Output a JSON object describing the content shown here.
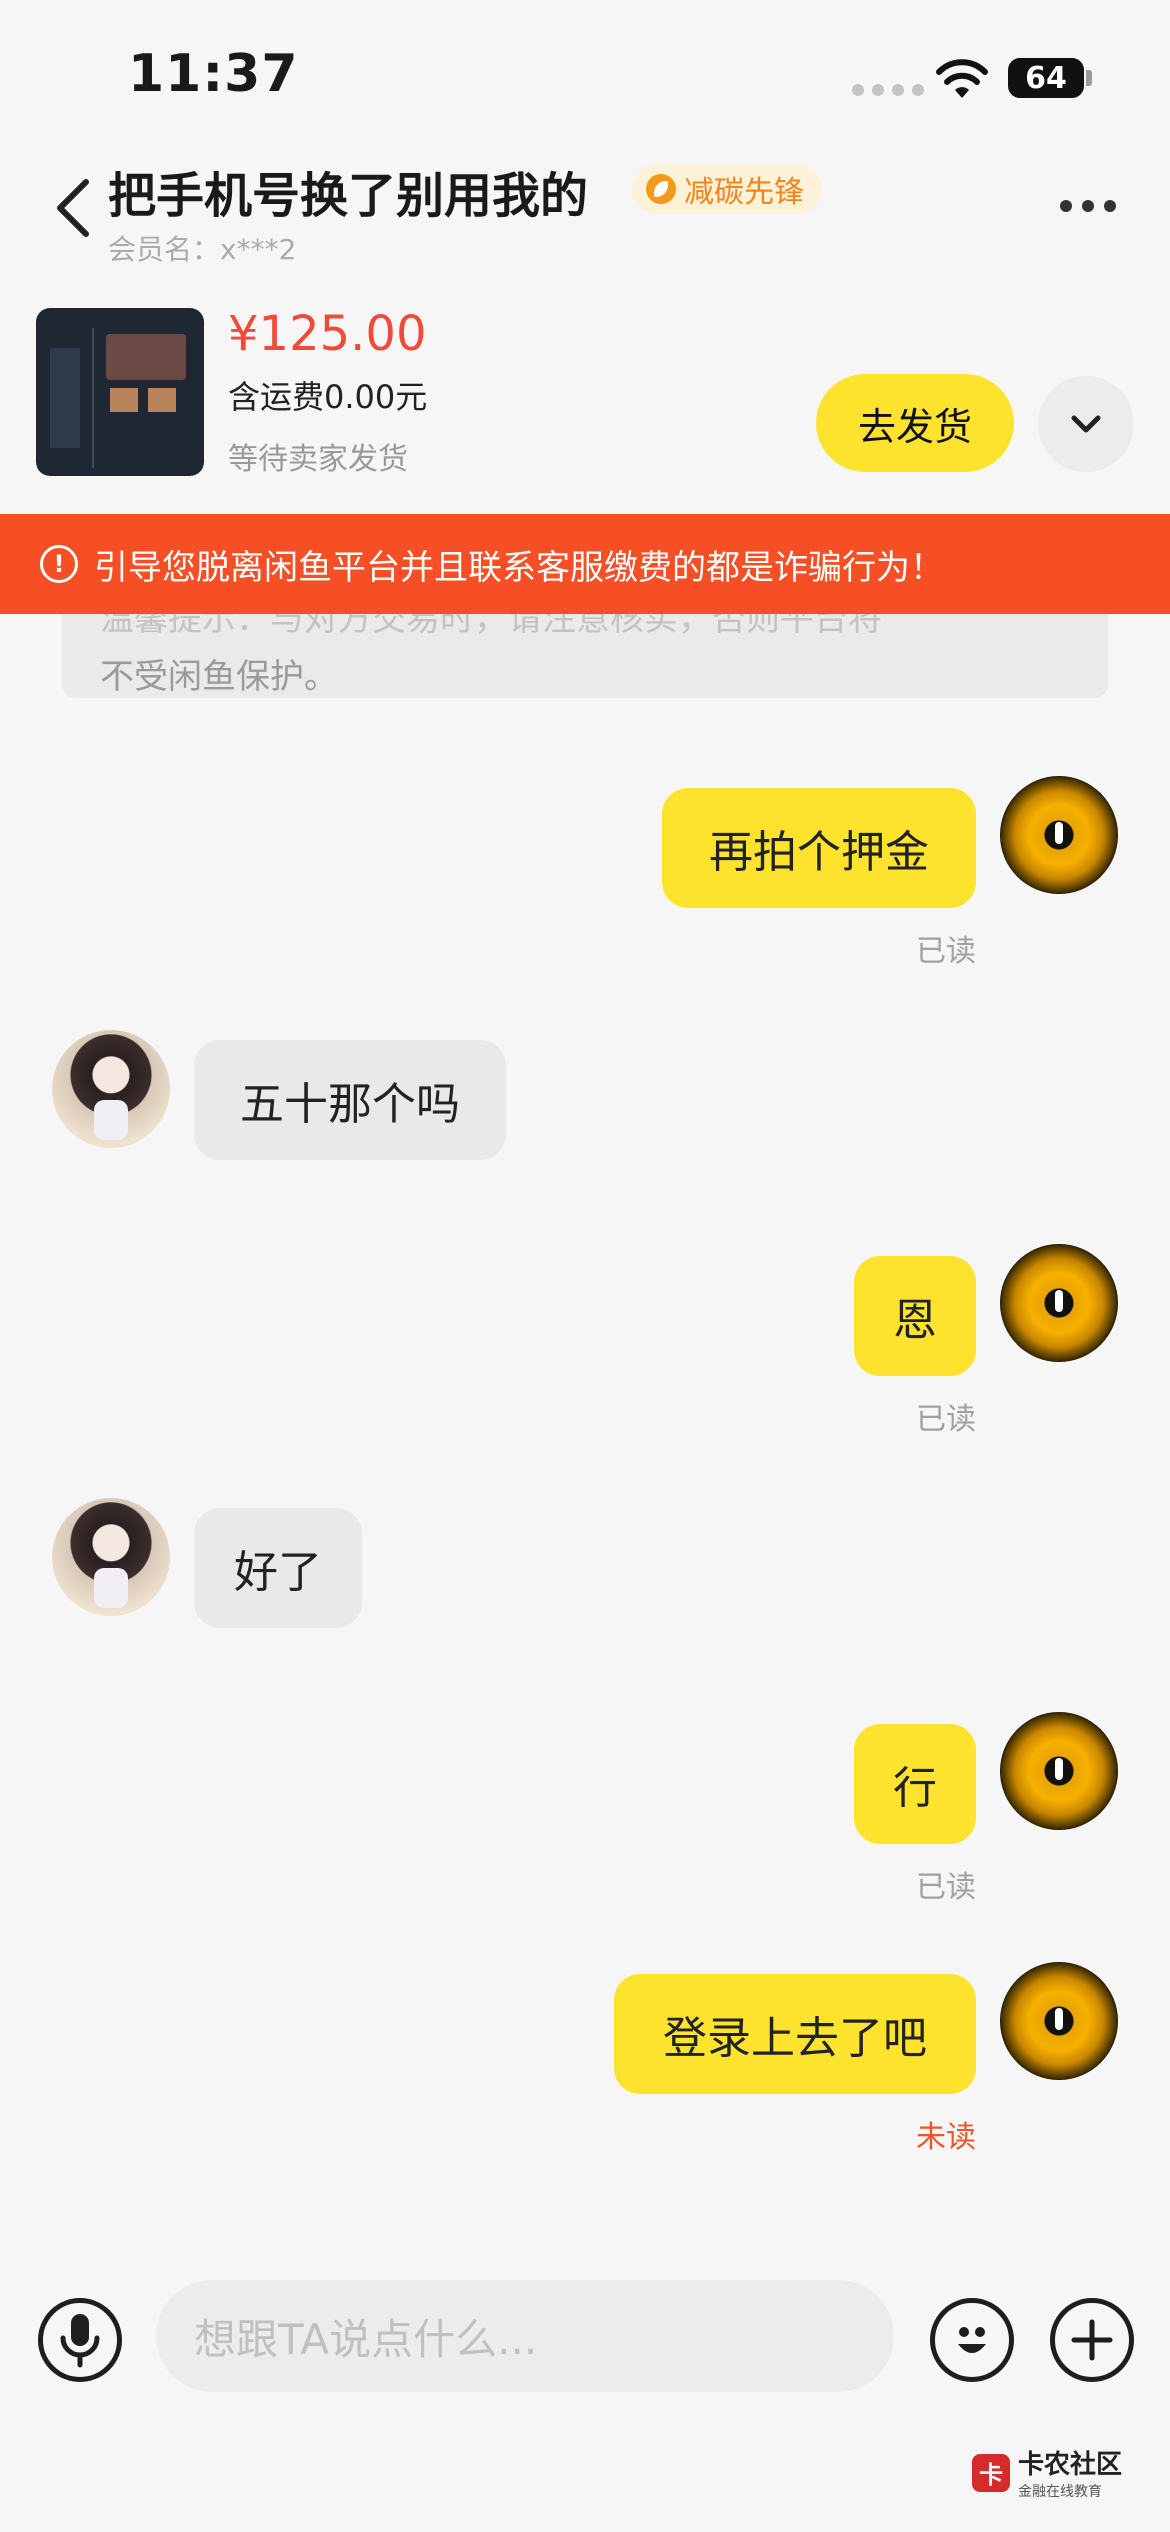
{
  "status_bar": {
    "time": "11:37",
    "battery": "64"
  },
  "header": {
    "title": "把手机号换了别用我的",
    "badge": "减碳先锋",
    "member": "会员名：x***2"
  },
  "product": {
    "price": "¥125.00",
    "shipping": "含运费0.00元",
    "status": "等待卖家发货",
    "ship_button": "去发货"
  },
  "warning": "引导您脱离闲鱼平台并且联系客服缴费的都是诈骗行为！",
  "notice": {
    "partial_line": "温馨提示：与对方交易时，请注意核实，否则平台将",
    "line": "不受闲鱼保护。"
  },
  "messages": [
    {
      "side": "me",
      "text": "再拍个押金",
      "status": "已读"
    },
    {
      "side": "them",
      "text": "五十那个吗"
    },
    {
      "side": "me",
      "text": "恩",
      "status": "已读"
    },
    {
      "side": "them",
      "text": "好了"
    },
    {
      "side": "me",
      "text": "行",
      "status": "已读"
    },
    {
      "side": "me",
      "text": "登录上去了吧",
      "status": "未读"
    }
  ],
  "input": {
    "placeholder": "想跟TA说点什么..."
  },
  "watermark": {
    "title": "卡农社区",
    "subtitle": "金融在线教育",
    "logo": "卡"
  },
  "colors": {
    "accent_yellow": "#fde22e",
    "warning_red": "#f64f26",
    "price_red": "#f04a3a",
    "unread_red": "#f0542c"
  }
}
